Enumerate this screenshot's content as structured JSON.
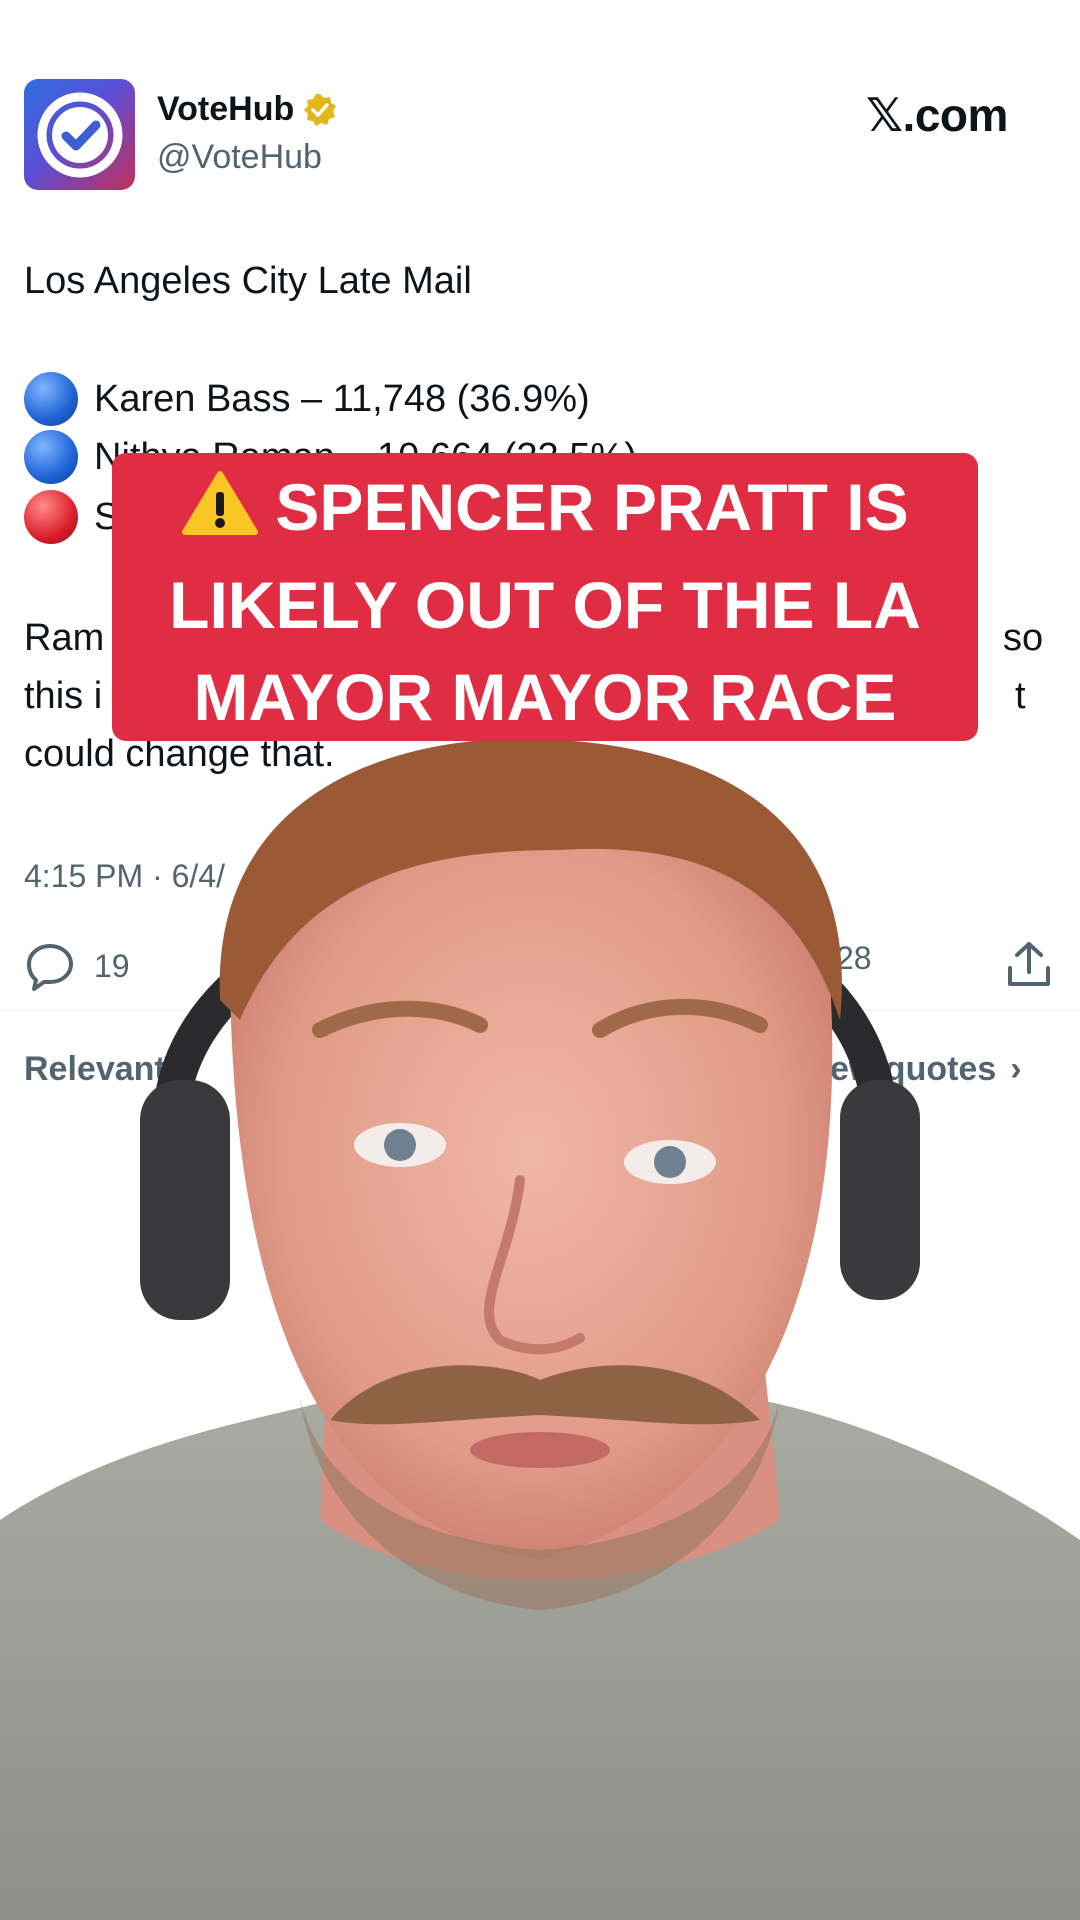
{
  "header": {
    "author_name": "VoteHub",
    "handle": "@VoteHub",
    "site_brand": "𝕏.com",
    "verified_icon": "verified-badge-icon",
    "logo_icon": "checkmark-icon"
  },
  "tweet": {
    "title": "Los Angeles City Late Mail",
    "results": [
      {
        "text": "Karen Bass – 11,748 (36.9%)",
        "dot_color": "#1f63d6"
      },
      {
        "text": "Nithya Raman – 10,664 (33.5%)",
        "dot_color": "#1f63d6"
      },
      {
        "text": "S",
        "dot_color": "#dc1f2c"
      }
    ],
    "body_lines": [
      "Ram",
      "so",
      "this i",
      "t",
      "could change that."
    ],
    "timestamp": "4:15 PM · 6/4/"
  },
  "actions": {
    "replies": "19",
    "likes_partial": "28",
    "reply_icon": "reply-icon",
    "share_icon": "share-icon"
  },
  "tabs": {
    "left": "Relevant",
    "right": "ew quotes"
  },
  "banner": {
    "icon": "warning-icon",
    "lines": [
      "SPENCER PRATT IS",
      "LIKELY OUT OF THE LA",
      "MAYOR MAYOR RACE"
    ]
  },
  "colors": {
    "banner_bg": "#e12d44",
    "text_primary": "#0f1419",
    "text_secondary": "#536471",
    "verified_gold": "#e2b719"
  }
}
